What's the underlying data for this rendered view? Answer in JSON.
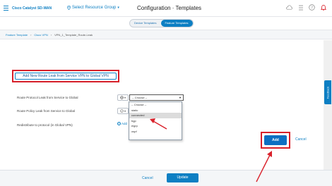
{
  "header": {
    "brand": "Cisco Catalyst SD-WAN",
    "resource_group": "Select Resource Group",
    "title": "Configuration · Templates"
  },
  "tabs": [
    {
      "label": "Device Templates",
      "active": false
    },
    {
      "label": "Feature Templates",
      "active": true
    }
  ],
  "breadcrumb": {
    "items": [
      "Feature Template",
      "Cisco VPN"
    ],
    "current": "VPN_1_Template_Route-Leak"
  },
  "form": {
    "add_leak_button": "Add New Route Leak from Service VPN to Global VPN",
    "route_protocol_label": "Route Protocol Leak from Service to Global",
    "route_policy_label": "Route Policy Leak from Service to Global",
    "redistribute_label": "Redistribute to protocol (in Global VPN)",
    "select_value": "-- Choose --",
    "add_link": "Add",
    "dropdown_options": [
      "-- Choose --",
      "static",
      "connected",
      "bgp",
      "eigrp",
      "ospf"
    ],
    "selected_option_index": 2,
    "add_button": "Add",
    "cancel_link": "Cancel"
  },
  "footer": {
    "cancel": "Cancel",
    "update": "Update"
  },
  "feedback_tab": "Feedback",
  "colors": {
    "accent": "#0d7fc3",
    "highlight": "#d9202a"
  }
}
